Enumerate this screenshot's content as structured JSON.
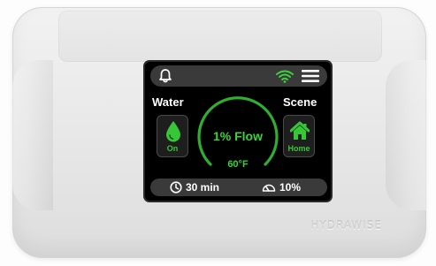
{
  "device": {
    "brand_text": "HYDRAWISE"
  },
  "screen": {
    "top_bar": {
      "bell_icon": "bell-icon",
      "wifi_icon": "wifi-icon",
      "menu_icon": "hamburger-menu-icon"
    },
    "water": {
      "label": "Water",
      "status": "On",
      "icon": "water-drop-icon"
    },
    "scene": {
      "label": "Scene",
      "value": "Home",
      "icon": "home-icon"
    },
    "dial": {
      "flow_text": "1% Flow",
      "temperature": "60°F",
      "flow_percent": 1
    },
    "bottom_bar": {
      "timer_icon": "clock-icon",
      "timer": "30 min",
      "level_icon": "gauge-icon",
      "level": "10%"
    }
  },
  "colors": {
    "accent_green": "#3cd23c",
    "screen_bg": "#000000",
    "bar_bg": "#3a3a3a"
  }
}
